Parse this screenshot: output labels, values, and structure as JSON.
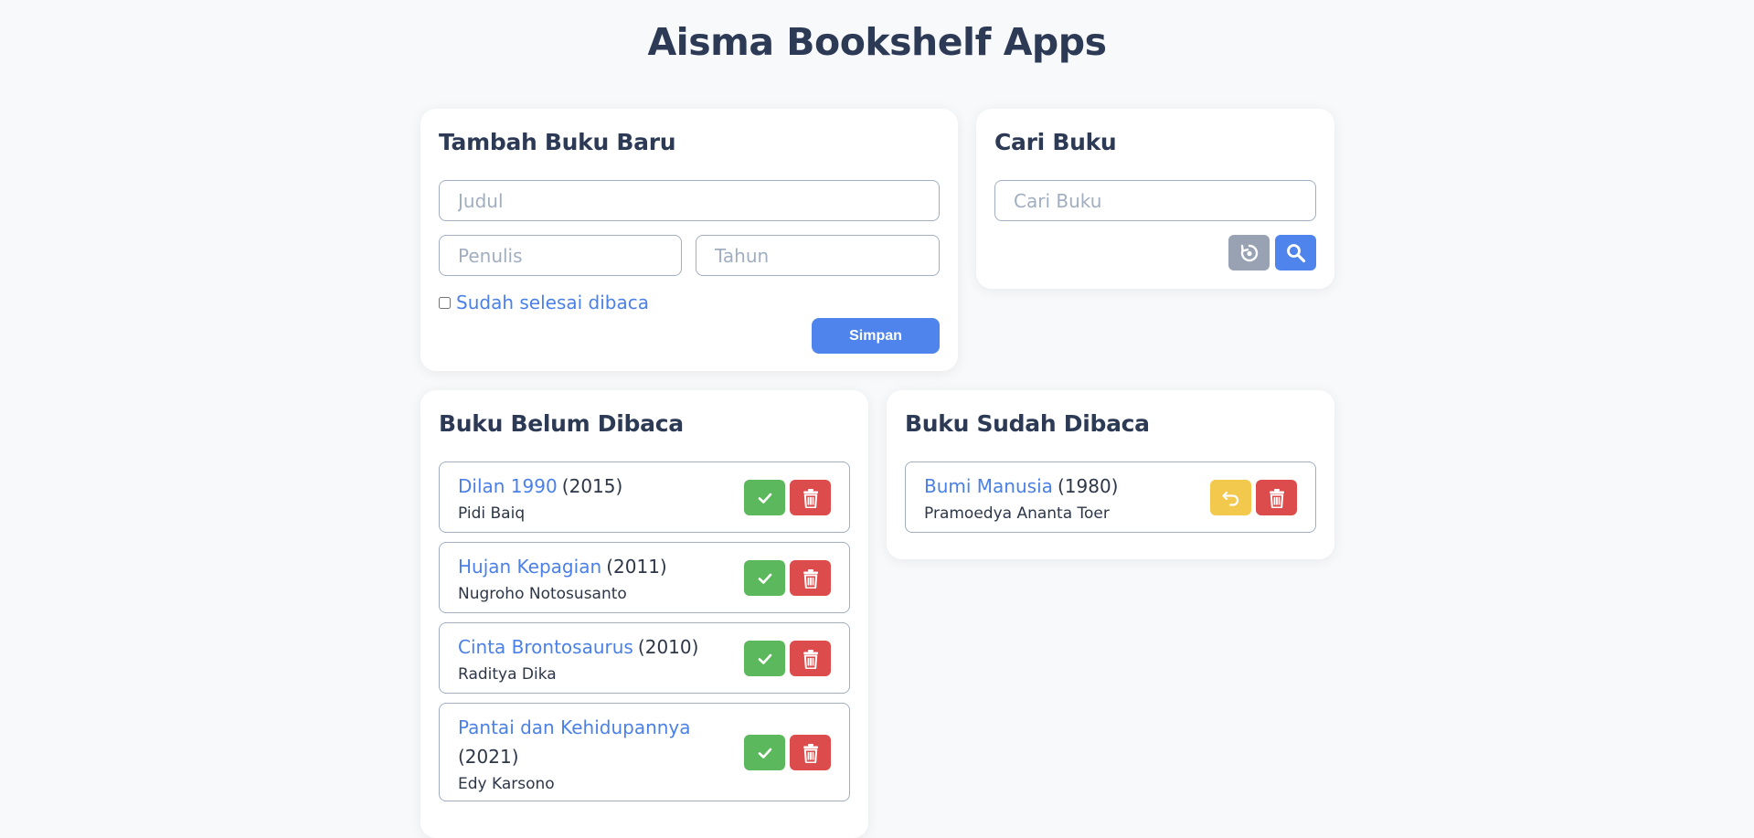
{
  "app": {
    "title": "Aisma Bookshelf Apps"
  },
  "add_form": {
    "heading": "Tambah Buku Baru",
    "title_placeholder": "Judul",
    "author_placeholder": "Penulis",
    "year_placeholder": "Tahun",
    "finished_label": "Sudah selesai dibaca",
    "finished_checked": false,
    "save_label": "Simpan"
  },
  "search": {
    "heading": "Cari Buku",
    "placeholder": "Cari Buku",
    "reset_icon": "reset-icon",
    "search_icon": "search-icon"
  },
  "unread": {
    "heading": "Buku Belum Dibaca",
    "books": [
      {
        "title": "Dilan 1990",
        "year": "(2015)",
        "author": "Pidi Baiq"
      },
      {
        "title": "Hujan Kepagian",
        "year": "(2011)",
        "author": "Nugroho Notosusanto"
      },
      {
        "title": "Cinta Brontosaurus",
        "year": "(2010)",
        "author": "Raditya Dika"
      },
      {
        "title": "Pantai dan Kehidupannya",
        "year": "(2021)",
        "author": "Edy Karsono"
      }
    ]
  },
  "read": {
    "heading": "Buku Sudah Dibaca",
    "books": [
      {
        "title": "Bumi Manusia",
        "year": "(1980)",
        "author": "Pramoedya Ananta Toer"
      }
    ]
  },
  "colors": {
    "accent": "#4f84ec",
    "done": "#5cb85c",
    "delete": "#dc4c4c",
    "undo": "#f2c94c",
    "reset": "#98a2b3"
  }
}
